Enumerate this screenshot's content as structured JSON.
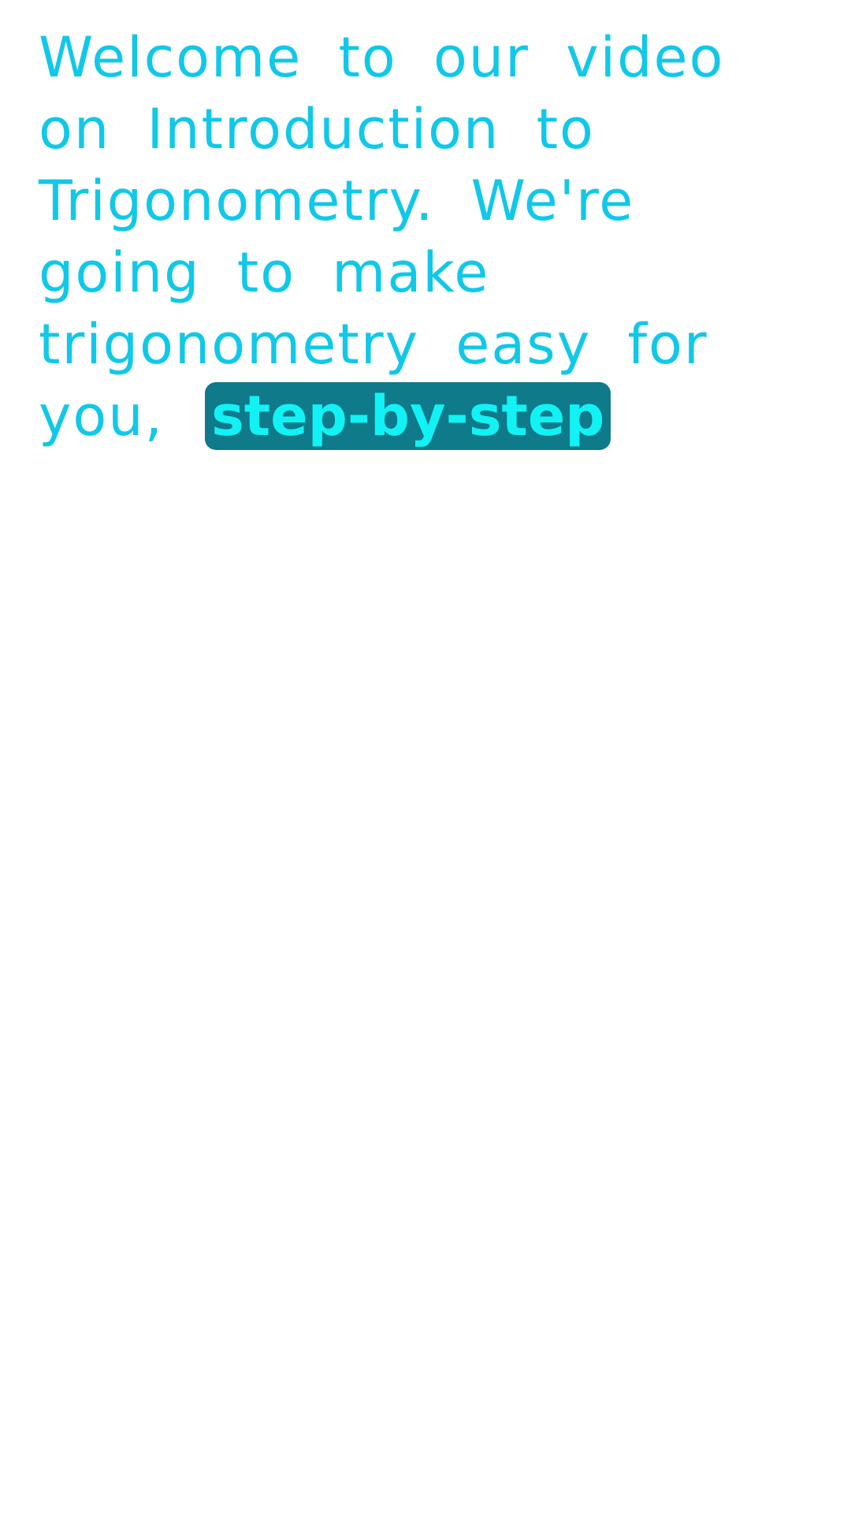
{
  "caption": {
    "lines": [
      "Welcome to our video",
      "on Introduction to",
      "Trigonometry. We're",
      "going to make",
      "trigonometry easy for",
      "you,"
    ],
    "highlight": "step-by-step"
  },
  "colors": {
    "text": "#10c8e8",
    "highlight_bg": "#0e7a8a",
    "highlight_text": "#12f2f4",
    "background": "#ffffff"
  }
}
